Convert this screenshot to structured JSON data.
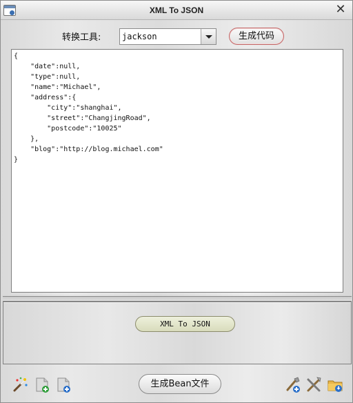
{
  "window": {
    "title": "XML To JSON",
    "close_glyph": "✕"
  },
  "toolbar": {
    "tool_label": "转换工具:",
    "tool_select_value": "jackson",
    "generate_code_label": "生成代码"
  },
  "editor": {
    "lines": [
      "{",
      "    \"date\":null,",
      "    \"type\":null,",
      "    \"name\":\"Michael\",",
      "    \"address\":{",
      "        \"city\":\"shanghai\",",
      "        \"street\":\"ChangjingRoad\",",
      "        \"postcode\":\"10025\"",
      "    },",
      "    \"blog\":\"http://blog.michael.com\"",
      "}"
    ]
  },
  "actions": {
    "xml_to_json_label": "XML To JSON",
    "generate_bean_label": "生成Bean文件"
  },
  "icons": {
    "left": [
      "magic-wand-icon",
      "add-file-icon",
      "add-file-blue-icon"
    ],
    "right": [
      "tool-add-icon",
      "tools-icon",
      "folder-download-icon"
    ]
  }
}
